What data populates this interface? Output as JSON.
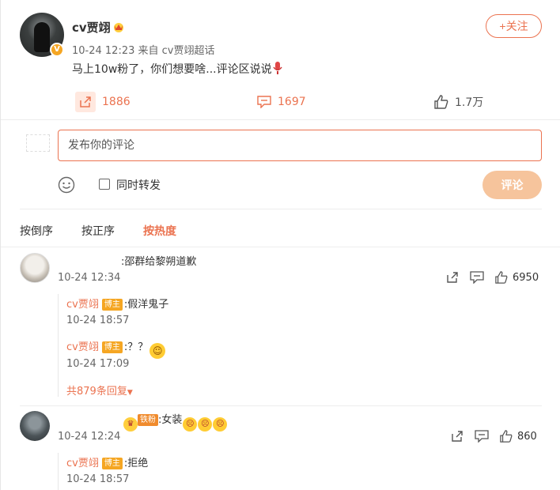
{
  "post": {
    "author": "cv贾翊",
    "meta": "10-24 12:23  来自 cv贾翊超话",
    "text": "马上10w粉了，你们想要啥...评论区说说",
    "follow_label": "+关注",
    "share_count": "1886",
    "comment_count": "1697",
    "like_count": "1.7万"
  },
  "composer": {
    "placeholder": "发布你的评论",
    "repost_label": "同时转发",
    "submit_label": "评论"
  },
  "sort": {
    "options": [
      "按倒序",
      "按正序",
      "按热度"
    ],
    "active": "按热度"
  },
  "comments": [
    {
      "text": ":邵群给黎朔道歉",
      "time": "10-24 12:34",
      "likes": "6950",
      "replies": [
        {
          "user": "cv贾翊",
          "badge": "博主",
          "text": ":假洋鬼子",
          "time": "10-24 18:57"
        },
        {
          "user": "cv贾翊",
          "badge": "博主",
          "text": ":？？",
          "time": "10-24 17:09"
        }
      ],
      "more_replies": "共879条回复"
    },
    {
      "fan_badge": "铁粉",
      "text": ":女装",
      "time": "10-24 12:24",
      "likes": "860",
      "replies": [
        {
          "user": "cv贾翊",
          "badge": "博主",
          "text": ":拒绝",
          "time": "10-24 18:57"
        }
      ]
    }
  ],
  "colors": {
    "accent": "#eb7350",
    "badge": "#f5a623",
    "submit_disabled": "#f6c49c"
  },
  "icons": [
    "vip-crown-icon",
    "verified-badge-icon",
    "share-icon",
    "comment-icon",
    "like-icon",
    "emoji-icon"
  ]
}
